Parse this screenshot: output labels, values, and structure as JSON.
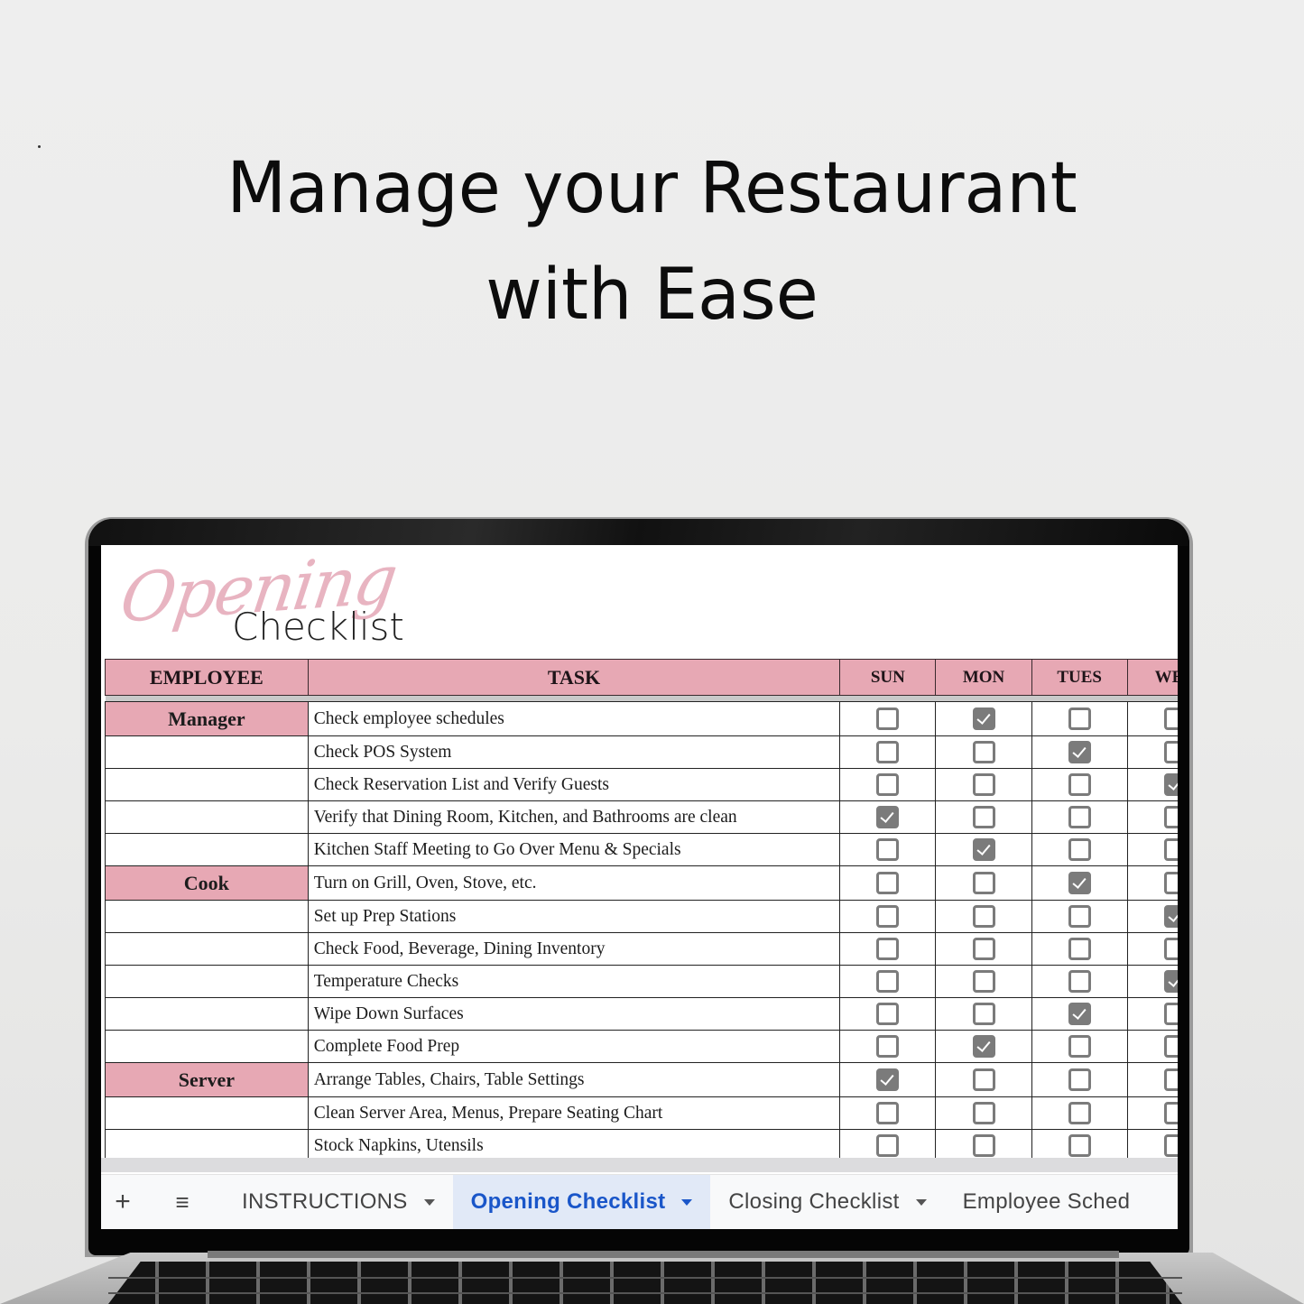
{
  "headline": {
    "line1": "Manage your Restaurant",
    "line2": "with Ease"
  },
  "sheet": {
    "title_script": "Opening",
    "title_main": "Checklist",
    "columns": {
      "employee": "EMPLOYEE",
      "task": "TASK",
      "days": [
        "SUN",
        "MON",
        "TUES",
        "WED"
      ]
    },
    "rows": [
      {
        "employee": "Manager",
        "task": "Check employee schedules",
        "checks": [
          false,
          true,
          false,
          false
        ]
      },
      {
        "employee": "",
        "task": "Check POS System",
        "checks": [
          false,
          false,
          true,
          false
        ]
      },
      {
        "employee": "",
        "task": "Check Reservation List and Verify Guests",
        "checks": [
          false,
          false,
          false,
          true
        ]
      },
      {
        "employee": "",
        "task": "Verify that Dining Room, Kitchen, and Bathrooms are clean",
        "checks": [
          true,
          false,
          false,
          false
        ]
      },
      {
        "employee": "",
        "task": "Kitchen Staff Meeting to Go Over Menu & Specials",
        "checks": [
          false,
          true,
          false,
          false
        ]
      },
      {
        "employee": "Cook",
        "task": "Turn on Grill, Oven, Stove, etc.",
        "checks": [
          false,
          false,
          true,
          false
        ]
      },
      {
        "employee": "",
        "task": "Set up Prep Stations",
        "checks": [
          false,
          false,
          false,
          true
        ]
      },
      {
        "employee": "",
        "task": "Check Food, Beverage, Dining Inventory",
        "checks": [
          false,
          false,
          false,
          false
        ]
      },
      {
        "employee": "",
        "task": "Temperature Checks",
        "checks": [
          false,
          false,
          false,
          true
        ]
      },
      {
        "employee": "",
        "task": "Wipe Down Surfaces",
        "checks": [
          false,
          false,
          true,
          false
        ]
      },
      {
        "employee": "",
        "task": "Complete Food Prep",
        "checks": [
          false,
          true,
          false,
          false
        ]
      },
      {
        "employee": "Server",
        "task": "Arrange Tables, Chairs, Table Settings",
        "checks": [
          true,
          false,
          false,
          false
        ]
      },
      {
        "employee": "",
        "task": "Clean Server Area, Menus, Prepare Seating Chart",
        "checks": [
          false,
          false,
          false,
          false
        ]
      },
      {
        "employee": "",
        "task": "Stock Napkins, Utensils",
        "checks": [
          false,
          false,
          false,
          false
        ]
      }
    ]
  },
  "tabbar": {
    "add_icon": "+",
    "menu_icon": "≡",
    "tabs": [
      {
        "label": "INSTRUCTIONS",
        "active": false,
        "has_caret": true
      },
      {
        "label": "Opening Checklist",
        "active": true,
        "has_caret": true
      },
      {
        "label": "Closing Checklist",
        "active": false,
        "has_caret": true
      },
      {
        "label": "Employee Sched",
        "active": false,
        "has_caret": false
      }
    ]
  },
  "colors": {
    "header_pink": "#e7a8b4",
    "script_pink": "#e8b4c1",
    "checkbox_gray": "#7b7b7b",
    "active_tab_blue": "#1a56c9",
    "active_tab_bg": "#e1e9f7"
  }
}
